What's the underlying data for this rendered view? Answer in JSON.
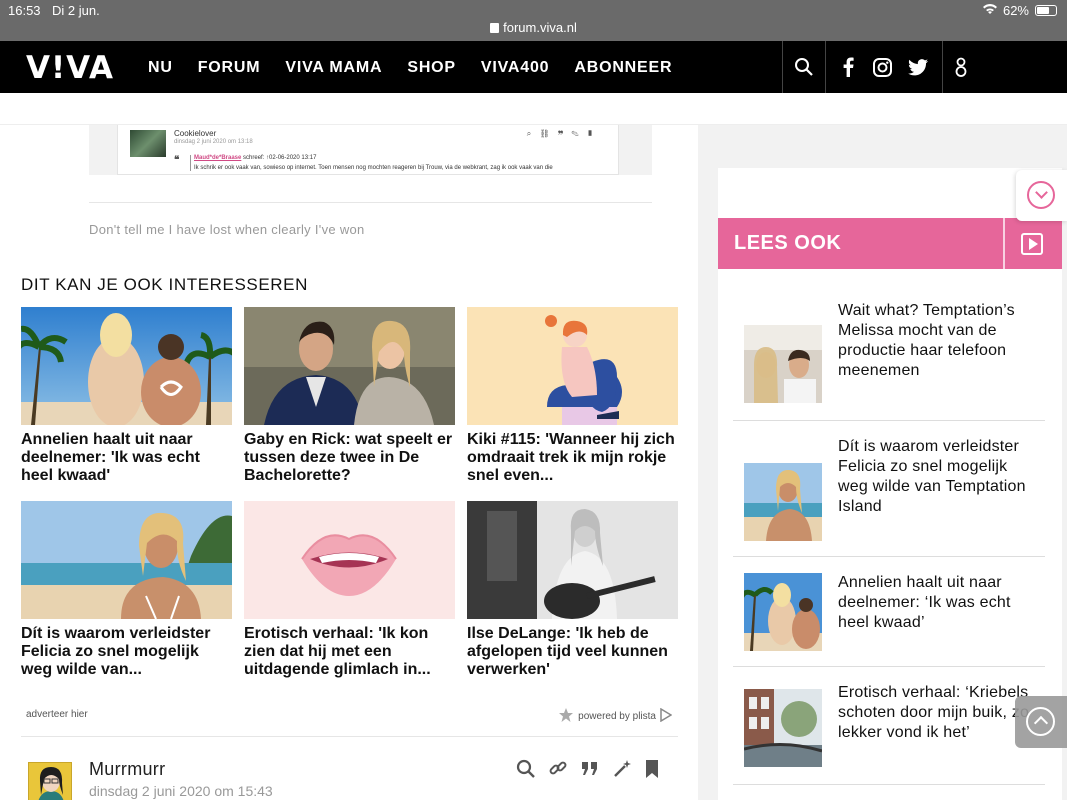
{
  "status_bar": {
    "time": "16:53",
    "date": "Di 2 jun.",
    "url": "forum.viva.nl",
    "battery": "62%"
  },
  "nav": {
    "logo": "V!VA",
    "links": [
      "NU",
      "FORUM",
      "VIVA MAMA",
      "SHOP",
      "VIVA400",
      "ABONNEER"
    ],
    "icons": [
      "search-icon",
      "facebook-icon",
      "instagram-icon",
      "twitter-icon",
      "user-icon"
    ]
  },
  "quoted_post": {
    "username": "Cookielover",
    "date": "dinsdag 2 juni 2020 om 13:18",
    "quote_author": "Maud*de*Braase",
    "quote_meta": "schreef: ↑02-06-2020 13:17",
    "quote_text": "Ik schrik er ook vaak van, sowieso op internet. Toen mensen nog mochten reageren bij Trouw, via de webkrant, zag ik ook vaak van die"
  },
  "signature": "Don't tell me I have lost when clearly I've won",
  "related": {
    "heading": "DIT KAN JE OOK INTERESSEREN",
    "cards": [
      {
        "title": "Annelien haalt uit naar deelnemer: 'Ik was echt heel kwaad'",
        "image": "beach-couple-photo"
      },
      {
        "title": "Gaby en Rick: wat speelt er tussen deze twee in De Bachelorette?",
        "image": "couple-photo"
      },
      {
        "title": "Kiki #115: 'Wanneer hij zich omdraait trek ik mijn rokje snel even...",
        "image": "illustration-girl"
      },
      {
        "title": "Dít is waarom verleidster Felicia zo snel mogelijk weg wilde van...",
        "image": "beach-woman-photo"
      },
      {
        "title": "Erotisch verhaal: 'Ik kon zien dat hij met een uitdagende glimlach in...",
        "image": "lips-illustration"
      },
      {
        "title": "Ilse DeLange: 'Ik heb de afgelopen tijd veel kunnen verwerken'",
        "image": "singer-guitar-photo"
      }
    ],
    "ad_left": "adverteer hier",
    "ad_right": "powered by plista"
  },
  "next_post": {
    "username": "Murrmurr",
    "date": "dinsdag 2 juni 2020 om 15:43"
  },
  "sidebar": {
    "heading": "LEES OOK",
    "items": [
      {
        "title": "Wait what? Temptation’s Melissa mocht van de productie haar telefoon meenemen"
      },
      {
        "title": "Dít is waarom verleidster Felicia zo snel mogelijk weg wilde van Temptation Island"
      },
      {
        "title": "Annelien haalt uit naar deelnemer: ‘Ik was echt heel kwaad’"
      },
      {
        "title": "Erotisch verhaal: ‘Kriebels schoten door mijn buik, zo lekker vond ik het’"
      }
    ]
  },
  "colors": {
    "brand_pink": "#e6669a",
    "nav_bg": "#000000"
  }
}
